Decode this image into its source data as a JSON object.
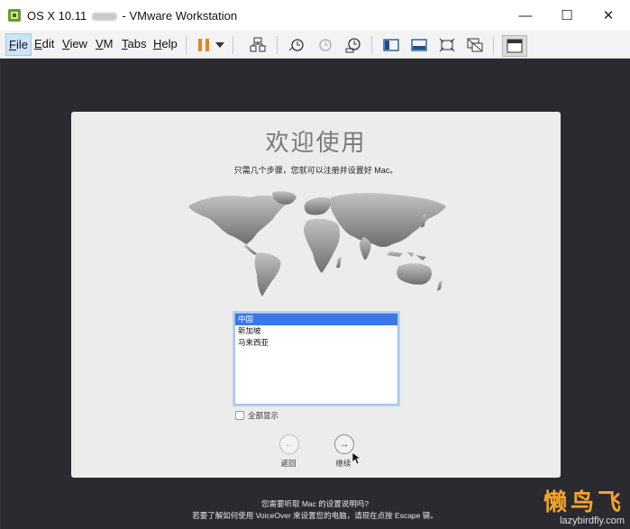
{
  "window": {
    "title_prefix": "OS X 10.11",
    "title_suffix": "- VMware Workstation",
    "controls": {
      "minimize": "—",
      "maximize": "☐",
      "close": "✕"
    }
  },
  "menu": {
    "items": [
      "File",
      "Edit",
      "View",
      "VM",
      "Tabs",
      "Help"
    ],
    "accelerators": [
      "F",
      "E",
      "V",
      "V",
      "T",
      "H"
    ]
  },
  "toolbar": {
    "icons": [
      "pause-icon",
      "dropdown-arrow-icon",
      "send-ctrl-alt-del-icon",
      "snapshot-icon",
      "revert-snapshot-icon",
      "snapshot-manager-icon",
      "show-library-icon",
      "console-view-icon",
      "full-screen-icon",
      "unity-icon",
      "thumbnail-bar-icon"
    ]
  },
  "setup": {
    "heading": "欢迎使用",
    "subtitle": "只需几个步骤，您就可以注册并设置好 Mac。",
    "countries": [
      "中国",
      "新加坡",
      "马来西亚"
    ],
    "selected_index": 0,
    "show_all_label": "全部显示",
    "back_label": "返回",
    "continue_label": "继续",
    "voiceover_line1": "您需要听取 Mac 的设置说明吗?",
    "voiceover_line2": "若要了解如何使用 VoiceOver 来设置您的电脑，请现在点按 Escape 键。"
  },
  "watermark": {
    "logo": "懒鸟飞",
    "url": "lazybirdfly.com"
  },
  "colors": {
    "vm_background": "#2a2a30",
    "panel": "#ececec",
    "selection": "#3b78e7",
    "pause_orange": "#e8821e",
    "watermark_orange": "#f3a52b"
  }
}
